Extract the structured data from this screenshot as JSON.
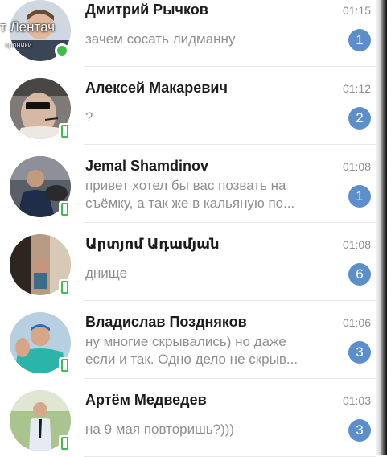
{
  "watermark": {
    "text": "т Лентач",
    "sub": "хроники"
  },
  "chats": [
    {
      "name": "Дмитрий Рычков",
      "time": "01:15",
      "message": "зачем сосать лидманну",
      "unread": "1",
      "status": "online"
    },
    {
      "name": "Алексей Макаревич",
      "time": "01:12",
      "message": "?",
      "unread": "2",
      "status": "mobile"
    },
    {
      "name": "Jemal Shamdinov",
      "time": "01:08",
      "message_line1": "привет хотел бы вас позвать на",
      "message_line2": "съёмку, а так же в кальяную по...",
      "unread": "1",
      "status": "mobile"
    },
    {
      "name": "Արտյոմ Ադամյան",
      "time": "01:08",
      "message": "днище",
      "unread": "6",
      "status": "mobile"
    },
    {
      "name": "Владислав Поздняков",
      "time": "01:06",
      "message_line1": "ну многие скрывались) но даже",
      "message_line2": "если и так. Одно дело не скрыв...",
      "unread": "3",
      "status": "mobile"
    },
    {
      "name": "Артём Медведев",
      "time": "01:03",
      "message": "на 9 мая повторишь?)))",
      "unread": "3",
      "status": "mobile"
    }
  ],
  "colors": {
    "badge": "#5b8fcc",
    "online": "#3cbf4a",
    "name": "#1c1c1c",
    "muted": "#8f8f8f"
  }
}
